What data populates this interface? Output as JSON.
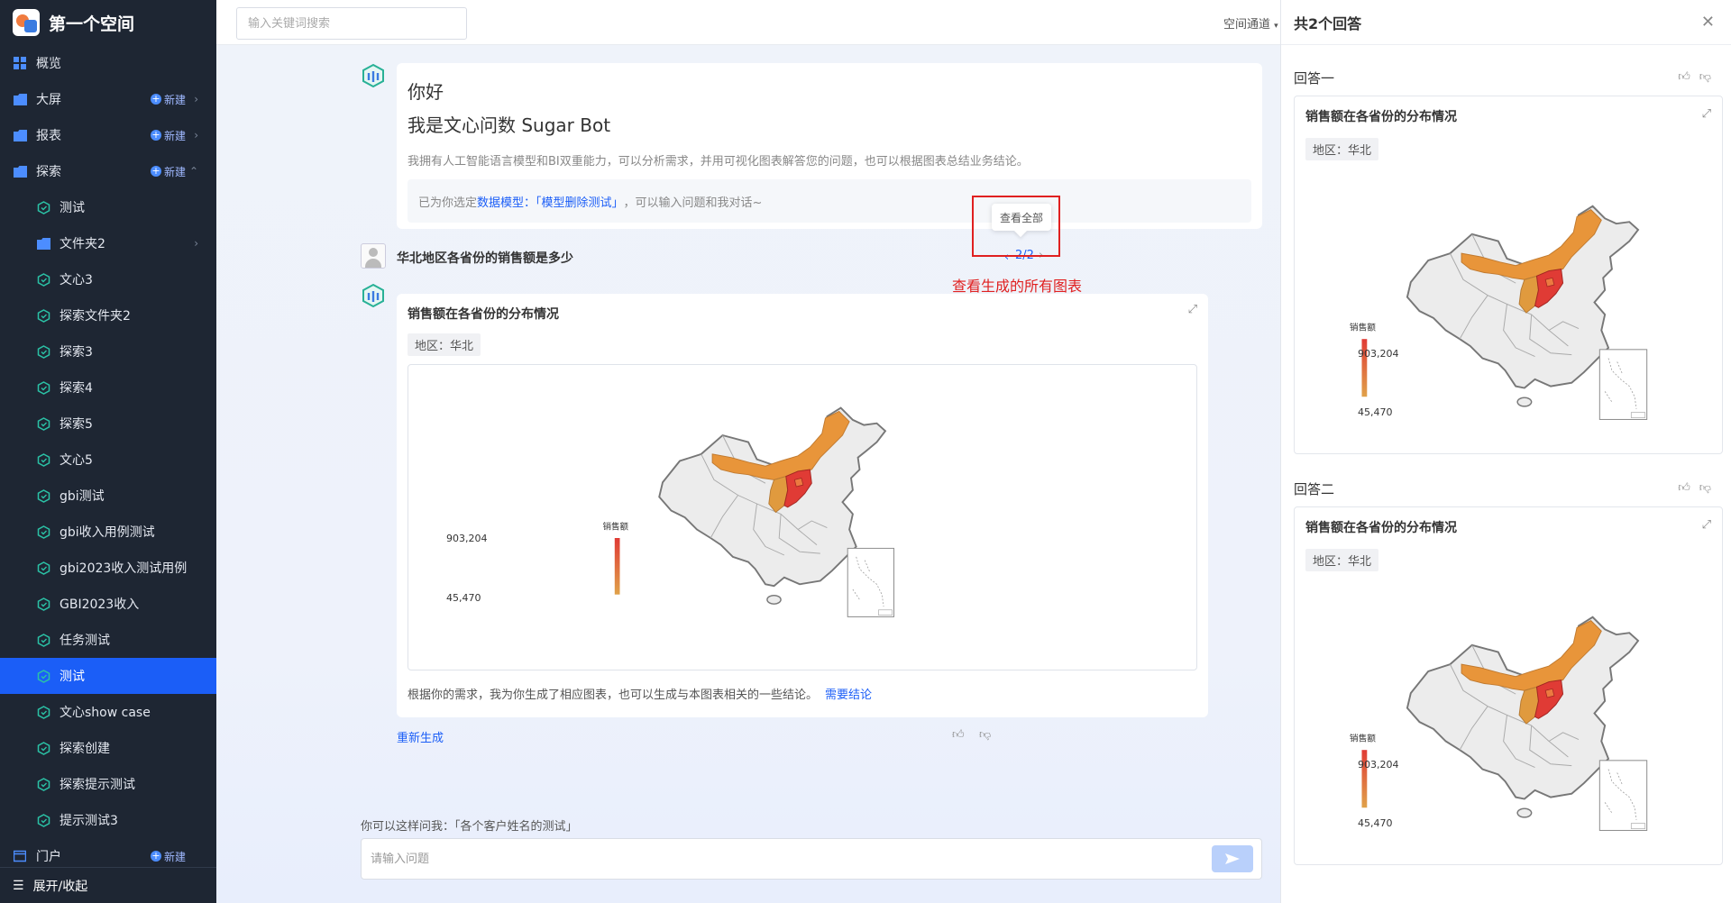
{
  "sidebar": {
    "title": "第一个空间",
    "items": [
      {
        "label": "概览",
        "icon": "grid-icon",
        "new": "",
        "type": "top"
      },
      {
        "label": "大屏",
        "icon": "folder-icon",
        "new": "新建",
        "type": "top"
      },
      {
        "label": "报表",
        "icon": "folder-icon",
        "new": "新建",
        "type": "top"
      },
      {
        "label": "探索",
        "icon": "folder-icon",
        "new": "新建",
        "type": "top"
      },
      {
        "label": "测试",
        "icon": "explore-icon",
        "type": "sub"
      },
      {
        "label": "文件夹2",
        "icon": "folder-icon",
        "type": "sub"
      },
      {
        "label": "文心3",
        "icon": "explore-icon",
        "type": "sub"
      },
      {
        "label": "探索文件夹2",
        "icon": "explore-icon",
        "type": "sub"
      },
      {
        "label": "探索3",
        "icon": "explore-icon",
        "type": "sub"
      },
      {
        "label": "探索4",
        "icon": "explore-icon",
        "type": "sub"
      },
      {
        "label": "探索5",
        "icon": "explore-icon",
        "type": "sub"
      },
      {
        "label": "文心5",
        "icon": "explore-icon",
        "type": "sub"
      },
      {
        "label": "gbi测试",
        "icon": "explore-icon",
        "type": "sub"
      },
      {
        "label": "gbi收入用例测试",
        "icon": "explore-icon",
        "type": "sub"
      },
      {
        "label": "gbi2023收入测试用例",
        "icon": "explore-icon",
        "type": "sub"
      },
      {
        "label": "GBI2023收入",
        "icon": "explore-icon",
        "type": "sub"
      },
      {
        "label": "任务测试",
        "icon": "explore-icon",
        "type": "sub"
      },
      {
        "label": "测试",
        "icon": "explore-icon",
        "type": "sub",
        "active": true
      },
      {
        "label": "文心show case",
        "icon": "explore-icon",
        "type": "sub"
      },
      {
        "label": "探索创建",
        "icon": "explore-icon",
        "type": "sub"
      },
      {
        "label": "探索提示测试",
        "icon": "explore-icon",
        "type": "sub"
      },
      {
        "label": "提示测试3",
        "icon": "explore-icon",
        "type": "sub"
      },
      {
        "label": "门户",
        "icon": "portal-icon",
        "new": "新建",
        "type": "top"
      }
    ],
    "footer": "展开/收起"
  },
  "topbar": {
    "search_placeholder": "输入关键词搜索",
    "channel": "空间通道"
  },
  "chat": {
    "hello": "你好",
    "bot_intro": "我是文心问数 Sugar Bot",
    "desc": "我拥有人工智能语言模型和BI双重能力，可以分析需求，并用可视化图表解答您的问题，也可以根据图表总结业务结论。",
    "model_prefix": "已为你选定",
    "model_link": "数据模型：「模型删除测试」",
    "model_suffix": "，可以输入问题和我对话~",
    "question": "华北地区各省份的销售额是多少",
    "answer_title": "销售额在各省份的分布情况",
    "region_tag": "地区：华北",
    "answer_foot": "根据你的需求，我为你生成了相应图表，也可以生成与本图表相关的一些结论。",
    "answer_foot_link": "需要结论",
    "regen": "重新生成",
    "pager": "2/2",
    "tooltip": "查看全部",
    "annotation": "查看生成的所有图表",
    "suggest": "你可以这样问我：「各个客户姓名的测试」",
    "input_placeholder": "请输入问题"
  },
  "legend": {
    "title": "销售额",
    "max": "903,204",
    "min": "45,470"
  },
  "panel": {
    "title": "共2个回答",
    "answers": [
      {
        "label": "回答一",
        "title": "销售额在各省份的分布情况",
        "tag": "地区：华北"
      },
      {
        "label": "回答二",
        "title": "销售额在各省份的分布情况",
        "tag": "地区：华北"
      }
    ]
  },
  "colors": {
    "accent": "#1b5ef7",
    "sidebar_bg": "#1e2633",
    "map_high": "#e03b35",
    "map_mid": "#e8953a",
    "map_low": "#d9a24a",
    "map_base": "#eeeeee",
    "annotation": "#e02020"
  }
}
